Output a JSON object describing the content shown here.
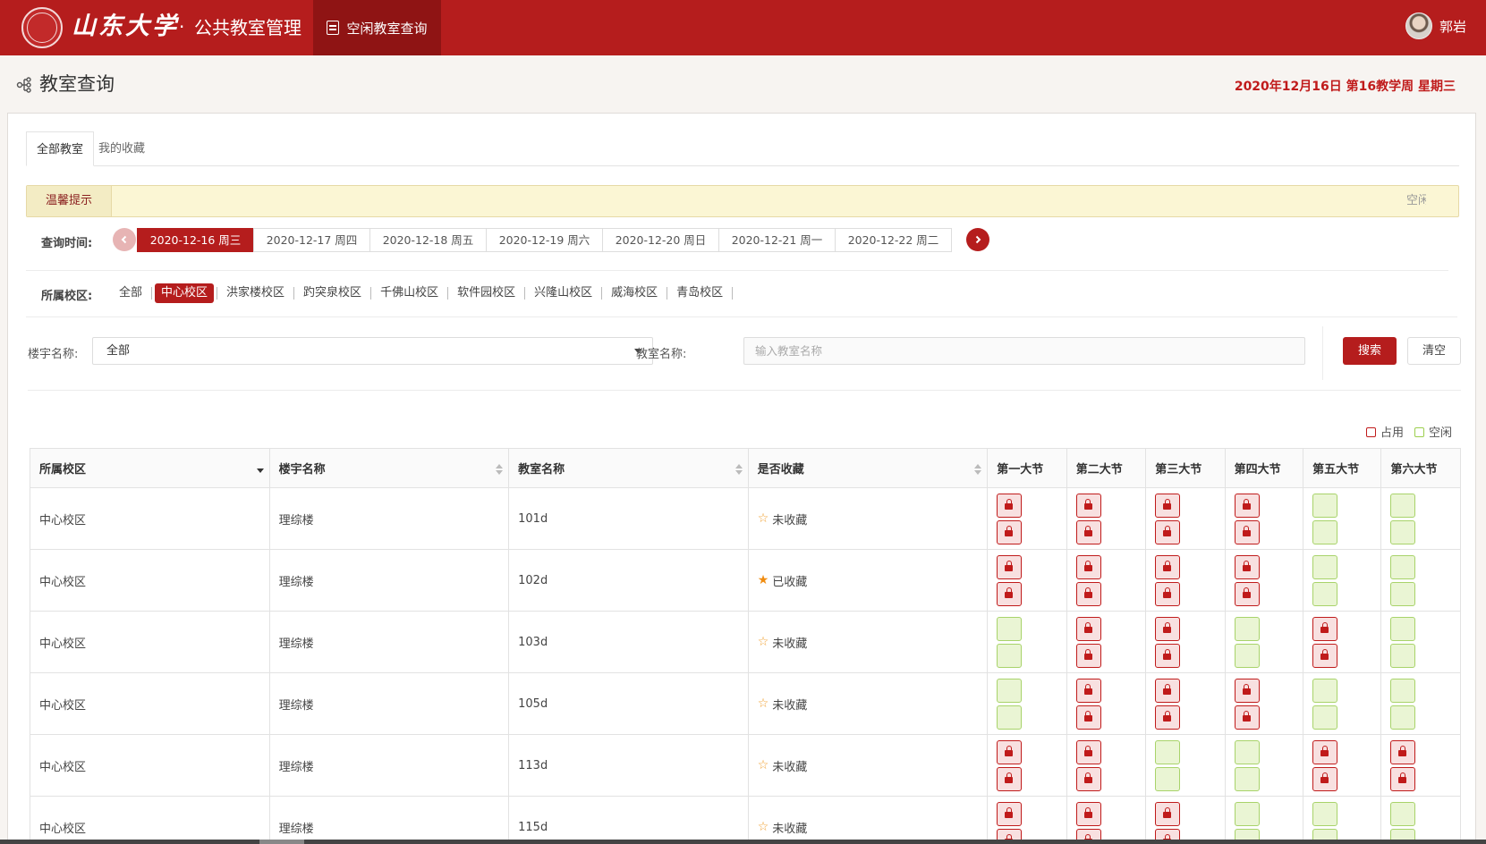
{
  "header": {
    "logo_text": "山东大学",
    "separator": "·",
    "system_title": "公共教室管理",
    "nav_active_label": "空闲教室查询",
    "user_name": "郭岩"
  },
  "page": {
    "title": "教室查询",
    "date_info": "2020年12月16日 第16教学周 星期三"
  },
  "tabs": [
    {
      "label": "全部教室",
      "active": true
    },
    {
      "label": "我的收藏",
      "active": false
    }
  ],
  "tip": {
    "label": "温馨提示",
    "scroll_text": "空闲"
  },
  "date_filter": {
    "label": "查询时间:",
    "dates": [
      {
        "label": "2020-12-16 周三",
        "active": true
      },
      {
        "label": "2020-12-17 周四",
        "active": false
      },
      {
        "label": "2020-12-18 周五",
        "active": false
      },
      {
        "label": "2020-12-19 周六",
        "active": false
      },
      {
        "label": "2020-12-20 周日",
        "active": false
      },
      {
        "label": "2020-12-21 周一",
        "active": false
      },
      {
        "label": "2020-12-22 周二",
        "active": false
      }
    ]
  },
  "campus_filter": {
    "label": "所属校区:",
    "items": [
      {
        "label": "全部",
        "active": false
      },
      {
        "label": "中心校区",
        "active": true
      },
      {
        "label": "洪家楼校区",
        "active": false
      },
      {
        "label": "趵突泉校区",
        "active": false
      },
      {
        "label": "千佛山校区",
        "active": false
      },
      {
        "label": "软件园校区",
        "active": false
      },
      {
        "label": "兴隆山校区",
        "active": false
      },
      {
        "label": "威海校区",
        "active": false
      },
      {
        "label": "青岛校区",
        "active": false
      }
    ]
  },
  "search": {
    "building_label": "楼宇名称:",
    "building_value": "全部",
    "room_label": "教室名称:",
    "room_placeholder": "输入教室名称",
    "search_button": "搜索",
    "clear_button": "清空"
  },
  "legend": {
    "occupied": "占用",
    "free": "空闲"
  },
  "table": {
    "headers": [
      "所属校区",
      "楼宇名称",
      "教室名称",
      "是否收藏",
      "第一大节",
      "第二大节",
      "第三大节",
      "第四大节",
      "第五大节",
      "第六大节"
    ],
    "rows": [
      {
        "campus": "中心校区",
        "building": "理综楼",
        "room": "101d",
        "fav": false,
        "fav_label": "未收藏",
        "slots": [
          [
            "occ",
            "occ"
          ],
          [
            "occ",
            "occ"
          ],
          [
            "occ",
            "occ"
          ],
          [
            "occ",
            "occ"
          ],
          [
            "free",
            "free"
          ],
          [
            "free",
            "free"
          ]
        ]
      },
      {
        "campus": "中心校区",
        "building": "理综楼",
        "room": "102d",
        "fav": true,
        "fav_label": "已收藏",
        "slots": [
          [
            "occ",
            "occ"
          ],
          [
            "occ",
            "occ"
          ],
          [
            "occ",
            "occ"
          ],
          [
            "occ",
            "occ"
          ],
          [
            "free",
            "free"
          ],
          [
            "free",
            "free"
          ]
        ]
      },
      {
        "campus": "中心校区",
        "building": "理综楼",
        "room": "103d",
        "fav": false,
        "fav_label": "未收藏",
        "slots": [
          [
            "free",
            "free"
          ],
          [
            "occ",
            "occ"
          ],
          [
            "occ",
            "occ"
          ],
          [
            "free",
            "free"
          ],
          [
            "occ",
            "occ"
          ],
          [
            "free",
            "free"
          ]
        ]
      },
      {
        "campus": "中心校区",
        "building": "理综楼",
        "room": "105d",
        "fav": false,
        "fav_label": "未收藏",
        "slots": [
          [
            "free",
            "free"
          ],
          [
            "occ",
            "occ"
          ],
          [
            "occ",
            "occ"
          ],
          [
            "occ",
            "occ"
          ],
          [
            "free",
            "free"
          ],
          [
            "free",
            "free"
          ]
        ]
      },
      {
        "campus": "中心校区",
        "building": "理综楼",
        "room": "113d",
        "fav": false,
        "fav_label": "未收藏",
        "slots": [
          [
            "occ",
            "occ"
          ],
          [
            "occ",
            "occ"
          ],
          [
            "free",
            "free"
          ],
          [
            "free",
            "free"
          ],
          [
            "occ",
            "occ"
          ],
          [
            "occ",
            "occ"
          ]
        ]
      },
      {
        "campus": "中心校区",
        "building": "理综楼",
        "room": "115d",
        "fav": false,
        "fav_label": "未收藏",
        "slots": [
          [
            "occ",
            "occ"
          ],
          [
            "occ",
            "occ"
          ],
          [
            "occ",
            "occ"
          ],
          [
            "free",
            "free"
          ],
          [
            "free",
            "free"
          ],
          [
            "free",
            "free"
          ]
        ]
      }
    ]
  }
}
